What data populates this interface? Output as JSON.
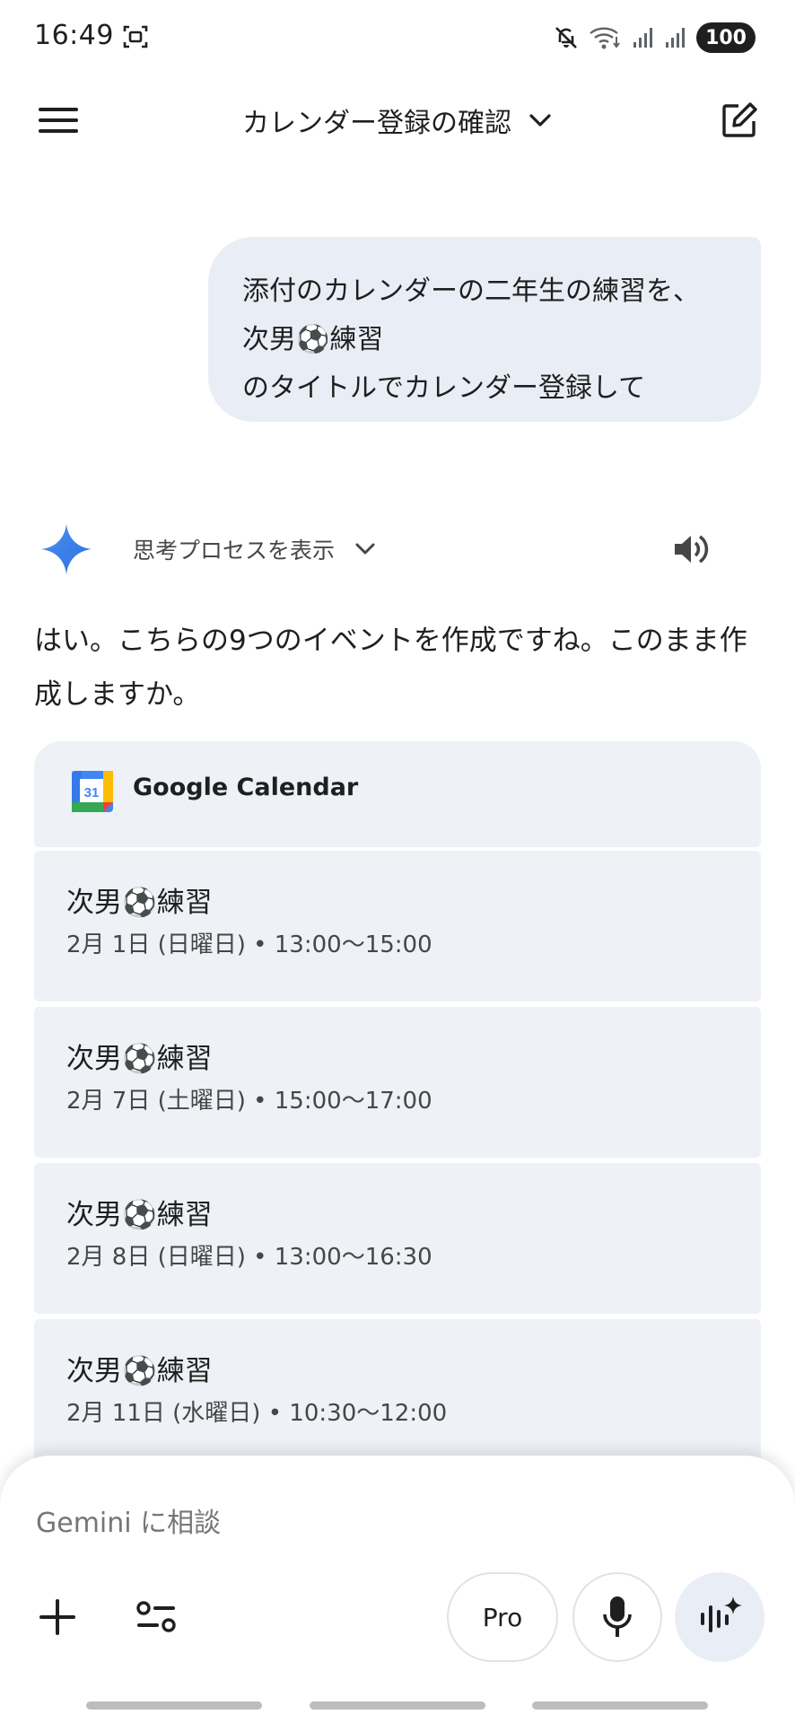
{
  "status_bar": {
    "time": "16:49",
    "battery": "100",
    "icons": [
      "screenshot-icon",
      "mute-icon",
      "wifi-icon",
      "signal-icon",
      "signal-icon",
      "battery-icon"
    ]
  },
  "app_bar": {
    "title": "カレンダー登録の確認",
    "icons": [
      "menu-icon",
      "chevron-down-icon",
      "edit-icon"
    ]
  },
  "user_message": {
    "lines": [
      "添付のカレンダーの二年生の練習を、",
      "次男⚽練習",
      "のタイトルでカレンダー登録して"
    ]
  },
  "response": {
    "thinking_label": "思考プロセスを表示",
    "text": "はい。こちらの9つのイベントを作成ですね。このまま作成しますか。",
    "icons": [
      "gemini-star-icon",
      "chevron-down-icon",
      "speaker-icon"
    ]
  },
  "calendar": {
    "title": "Google Calendar",
    "icon_day": "31",
    "events": [
      {
        "title": "次男⚽練習",
        "time": "2月 1日 (日曜日) • 13:00〜15:00"
      },
      {
        "title": "次男⚽練習",
        "time": "2月 7日 (土曜日) • 15:00〜17:00"
      },
      {
        "title": "次男⚽練習",
        "time": "2月 8日 (日曜日) • 13:00〜16:30"
      },
      {
        "title": "次男⚽練習",
        "time": "2月 11日 (水曜日) • 10:30〜12:00"
      }
    ]
  },
  "input": {
    "placeholder": "Gemini に相談",
    "value": "",
    "pro_label": "Pro",
    "icons": [
      "plus-icon",
      "tools-icon",
      "mic-icon",
      "live-icon"
    ]
  },
  "colors": {
    "bubble": "#e9eef6",
    "card": "#eef1f6",
    "text": "#1f1f1f",
    "secondary_text": "#444746",
    "gemini_blue": "#4285f4"
  }
}
